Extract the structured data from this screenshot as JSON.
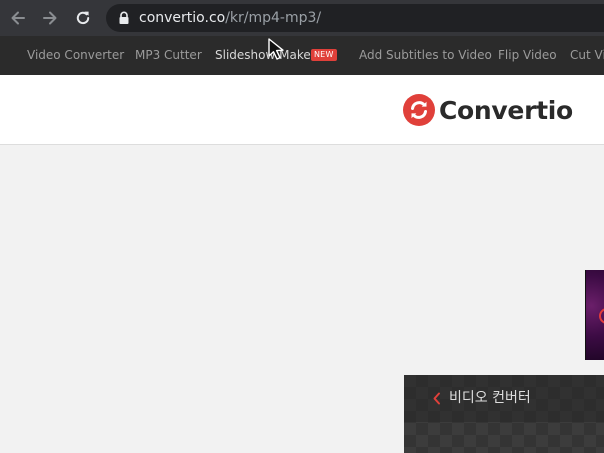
{
  "browser": {
    "url_host": "convertio.co",
    "url_path": "/kr/mp4-mp3/"
  },
  "toolbar": {
    "items": [
      {
        "label": "Video Converter"
      },
      {
        "label": "MP3 Cutter"
      },
      {
        "label": "Slideshow Maker",
        "badge": "NEW"
      },
      {
        "label": "Add Subtitles to Video"
      },
      {
        "label": "Flip Video"
      },
      {
        "label": "Cut Vid"
      }
    ]
  },
  "header": {
    "logo_text": "Convertio"
  },
  "panel": {
    "title": "비디오 컨버터"
  },
  "colors": {
    "brand_red": "#e0403a",
    "toolbar_bg": "#2b2b2b",
    "chrome_bg": "#35363a"
  },
  "icons": {
    "back": "back-arrow-icon",
    "forward": "forward-arrow-icon",
    "reload": "reload-icon",
    "lock": "lock-icon",
    "logo": "convertio-logo-icon",
    "chevron": "chevron-left-icon"
  }
}
